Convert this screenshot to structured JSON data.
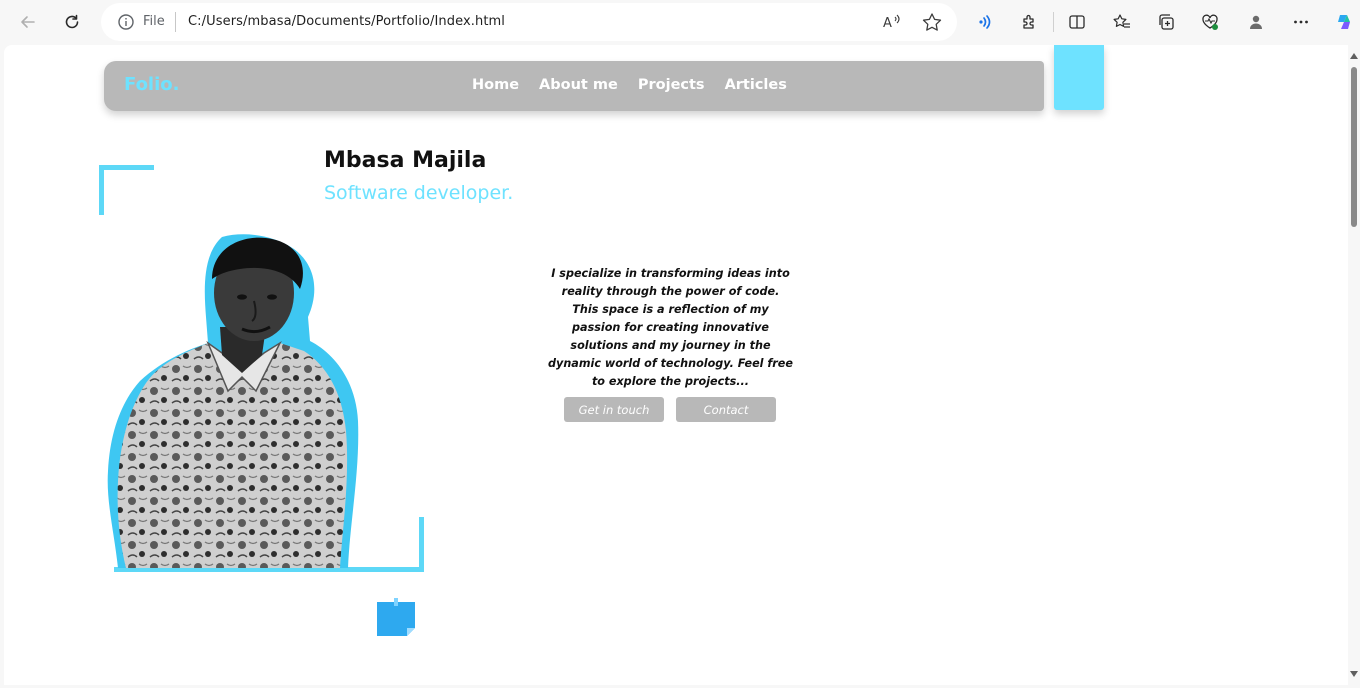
{
  "browser": {
    "scheme_label": "File",
    "url": "C:/Users/mbasa/Documents/Portfolio/Index.html",
    "icons": [
      "back-arrow-icon",
      "refresh-icon",
      "info-icon",
      "read-aloud-icon",
      "favorite-star-icon",
      "wifi-signal-icon",
      "extensions-icon",
      "split-screen-icon",
      "favorites-icon",
      "collections-icon",
      "health-icon",
      "profile-icon",
      "more-icon",
      "copilot-icon"
    ]
  },
  "site": {
    "brand": "Folio.",
    "nav": [
      "Home",
      "About me",
      "Projects",
      "Articles"
    ],
    "name": "Mbasa Majila",
    "role": "Software developer.",
    "bio": "I specialize in transforming ideas into reality through the power of code. This space is a reflection of my passion for creating innovative solutions and my journey in the dynamic world of technology. Feel free to explore the projects...",
    "buttons": {
      "get_in_touch": "Get in touch",
      "contact": "Contact"
    }
  },
  "colors": {
    "accent": "#6ee2ff",
    "navbar": "#b8b8b8",
    "button": "#b8b8b8",
    "text": "#111111"
  }
}
